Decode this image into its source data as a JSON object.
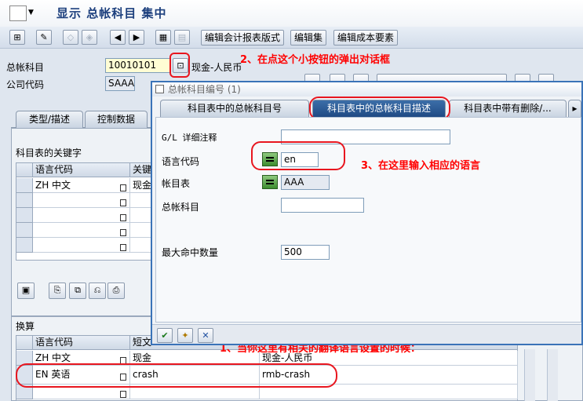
{
  "title": "显示 总帐科目 集中",
  "toolbar": {
    "btn1": "编辑会计报表版式",
    "btn2": "编辑集",
    "btn3": "编辑成本要素"
  },
  "header": {
    "account_label": "总帐科目",
    "account_value": "10010101",
    "account_desc": "现金-人民币",
    "company_label": "公司代码",
    "company_value": "SAAA"
  },
  "annotations": {
    "a1": "1、当你这里有相关的翻译语言设置的时候：",
    "a2": "2、在点这个小按钮的弹出对话框",
    "a3": "3、在这里输入相应的语言"
  },
  "main_tabs": [
    "类型/描述",
    "控制数据"
  ],
  "keyword_section": {
    "title": "科目表的关键字",
    "col1": "语言代码",
    "col2": "关键",
    "rows": [
      {
        "lang": "ZH 中文",
        "kw": "现金"
      },
      {
        "lang": "",
        "kw": ""
      },
      {
        "lang": "",
        "kw": ""
      },
      {
        "lang": "",
        "kw": ""
      },
      {
        "lang": "",
        "kw": ""
      }
    ]
  },
  "translation_section": {
    "title": "换算",
    "col1": "语言代码",
    "col2": "短文",
    "col3": "",
    "rows": [
      {
        "lang": "ZH 中文",
        "short": "现金",
        "long": "现金-人民币"
      },
      {
        "lang": "EN 英语",
        "short": "crash",
        "long": "rmb-crash"
      },
      {
        "lang": "",
        "short": "",
        "long": ""
      }
    ]
  },
  "dialog": {
    "title": "总帐科目编号 (1)",
    "tabs": [
      "科目表中的总帐科目号",
      "科目表中的总帐科目描述",
      "科目表中带有删除/..."
    ],
    "fields": {
      "gl_note_label": "G/L 详细注释",
      "gl_note_value": "",
      "lang_label": "语言代码",
      "lang_value": "en",
      "coa_label": "帐目表",
      "coa_value": "AAA",
      "acct_label": "总帐科目",
      "acct_value": "",
      "max_label": "最大命中数量",
      "max_value": "500"
    }
  }
}
